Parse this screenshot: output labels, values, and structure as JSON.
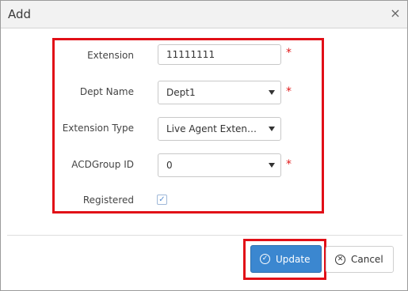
{
  "dialog": {
    "title": "Add",
    "close_glyph": "×"
  },
  "form": {
    "extension": {
      "label": "Extension",
      "value": "11111111",
      "required_mark": "*"
    },
    "dept_name": {
      "label": "Dept Name",
      "value": "Dept1",
      "required_mark": "*"
    },
    "extension_type": {
      "label": "Extension Type",
      "value": "Live Agent Extensi..."
    },
    "acd_group_id": {
      "label": "ACDGroup ID",
      "value": "0",
      "required_mark": "*"
    },
    "registered": {
      "label": "Registered",
      "checked": true,
      "check_glyph": "✓"
    }
  },
  "footer": {
    "update_label": "Update",
    "update_icon": "check-circle-icon",
    "cancel_label": "Cancel",
    "cancel_icon": "x-circle-icon"
  },
  "colors": {
    "highlight": "#e10f17",
    "primary": "#3b87d0",
    "required": "#e11a1a"
  }
}
